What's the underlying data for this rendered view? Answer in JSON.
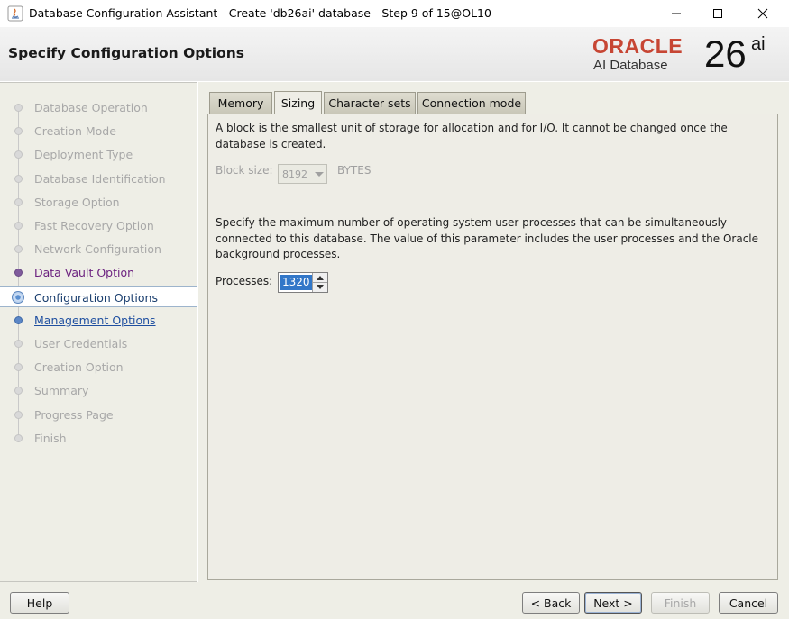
{
  "window": {
    "title": "Database Configuration Assistant - Create 'db26ai' database - Step 9 of 15@OL10"
  },
  "header": {
    "page_title": "Specify Configuration Options",
    "logo_brand": "ORACLE",
    "logo_product": "AI Database",
    "logo_version": "26",
    "logo_version_sup": "ai"
  },
  "sidebar": {
    "steps": [
      {
        "label": "Database Operation",
        "state": "disabled"
      },
      {
        "label": "Creation Mode",
        "state": "disabled"
      },
      {
        "label": "Deployment Type",
        "state": "disabled"
      },
      {
        "label": "Database Identification",
        "state": "disabled"
      },
      {
        "label": "Storage Option",
        "state": "disabled"
      },
      {
        "label": "Fast Recovery Option",
        "state": "disabled"
      },
      {
        "label": "Network Configuration",
        "state": "disabled"
      },
      {
        "label": "Data Vault Option",
        "state": "visited"
      },
      {
        "label": "Configuration Options",
        "state": "current"
      },
      {
        "label": "Management Options",
        "state": "link"
      },
      {
        "label": "User Credentials",
        "state": "disabled"
      },
      {
        "label": "Creation Option",
        "state": "disabled"
      },
      {
        "label": "Summary",
        "state": "disabled"
      },
      {
        "label": "Progress Page",
        "state": "disabled"
      },
      {
        "label": "Finish",
        "state": "disabled"
      }
    ]
  },
  "tabs": {
    "memory": "Memory",
    "sizing": "Sizing",
    "character_sets": "Character sets",
    "connection_mode": "Connection mode",
    "active": "Sizing"
  },
  "sizing": {
    "block_desc": "A block is the smallest unit of storage for allocation and for I/O. It cannot be changed once the database is created.",
    "block_size_label": "Block size:",
    "block_size_value": "8192",
    "block_size_unit": "BYTES",
    "processes_desc": "Specify the maximum number of operating system user processes that can be simultaneously connected to this database. The value of this parameter includes the user processes and the Oracle background processes.",
    "processes_label": "Processes:",
    "processes_value": "1320"
  },
  "footer": {
    "help": "Help",
    "back": "< Back",
    "next": "Next >",
    "finish": "Finish",
    "cancel": "Cancel"
  }
}
